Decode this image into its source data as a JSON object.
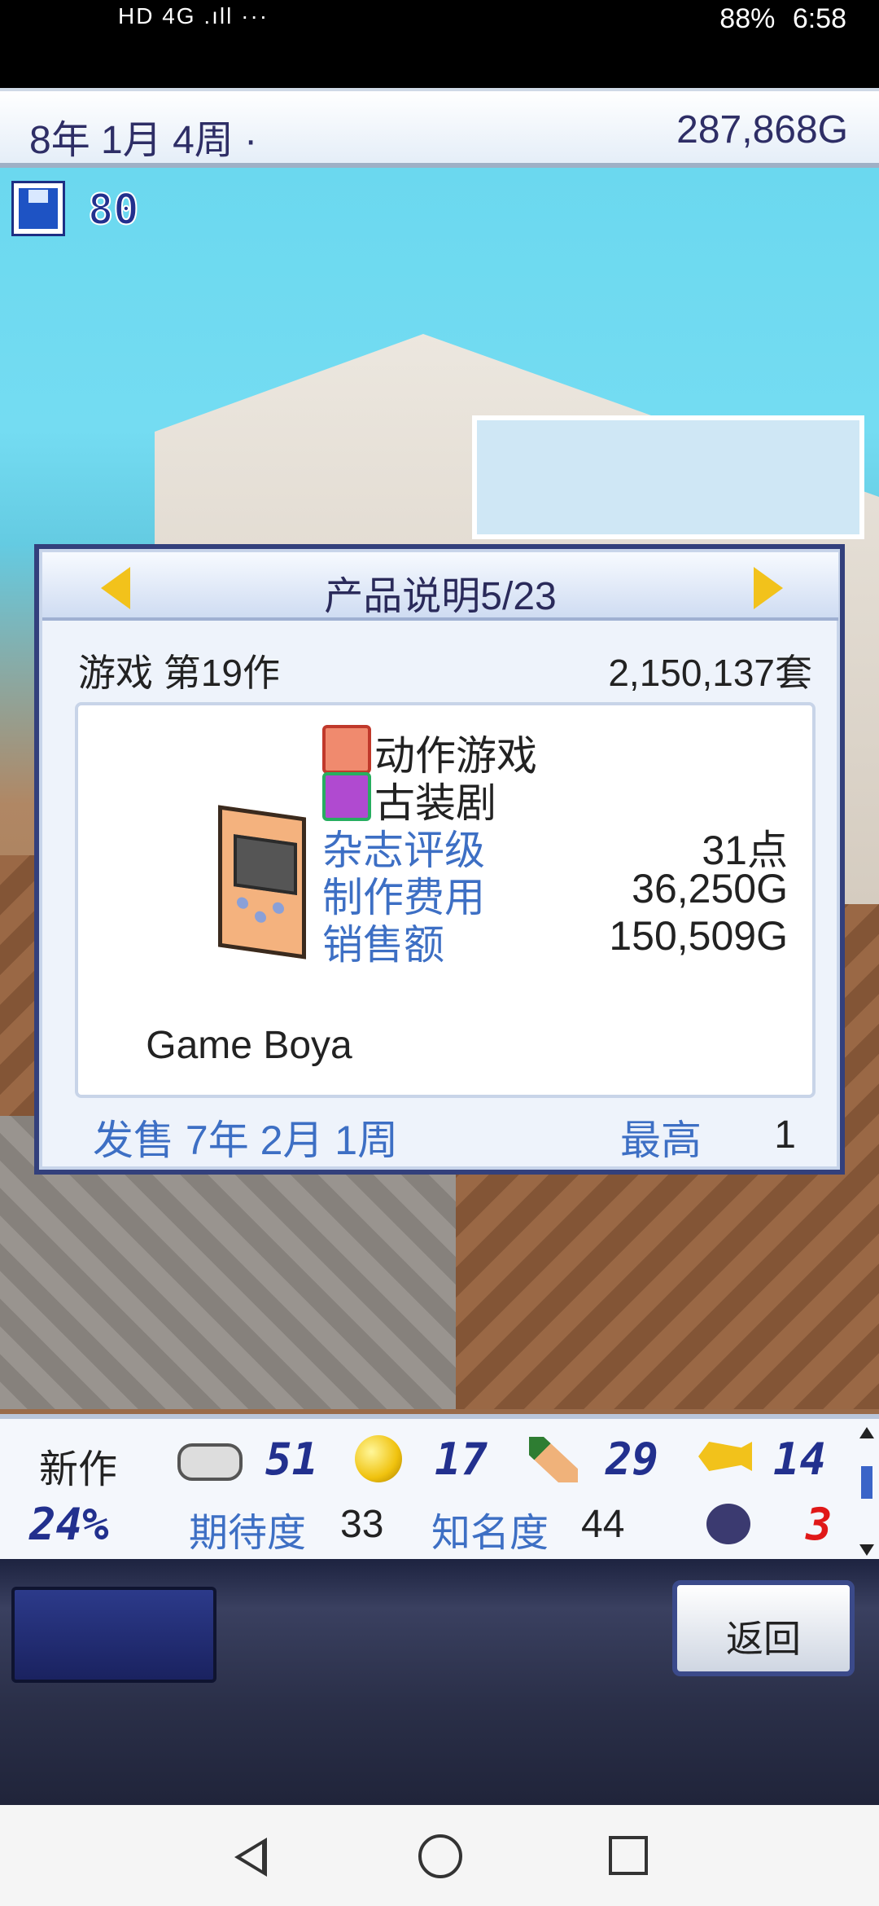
{
  "status_bar": {
    "left": "HD 4G .ıll",
    "more": "···",
    "battery": "88%",
    "time": "6:58"
  },
  "top_bar": {
    "date": "8年 1月 4周 ·",
    "money": "287,868G"
  },
  "save_count": "80",
  "dialog": {
    "title": "产品说明5/23",
    "game_label": "游戏 第19作",
    "copies": "2,150,137套",
    "product_name": "Game Boya",
    "genre1": "动作游戏",
    "genre2": "古装剧",
    "magazine_label": "杂志评级",
    "magazine_value": "31点",
    "cost_label": "制作费用",
    "cost_value": "36,250G",
    "sales_label": "销售额",
    "sales_value": "150,509G",
    "release": "发售 7年 2月 1周",
    "best_label": "最高",
    "best_value": "1"
  },
  "stats_panel": {
    "new_label": "新作",
    "new_percent": "24%",
    "fun": "51",
    "creativity": "17",
    "graphics": "29",
    "sound": "14",
    "expectation_label": "期待度",
    "expectation_value": "33",
    "fame_label": "知名度",
    "fame_value": "44",
    "bugs": "3"
  },
  "buttons": {
    "back": "返回"
  }
}
